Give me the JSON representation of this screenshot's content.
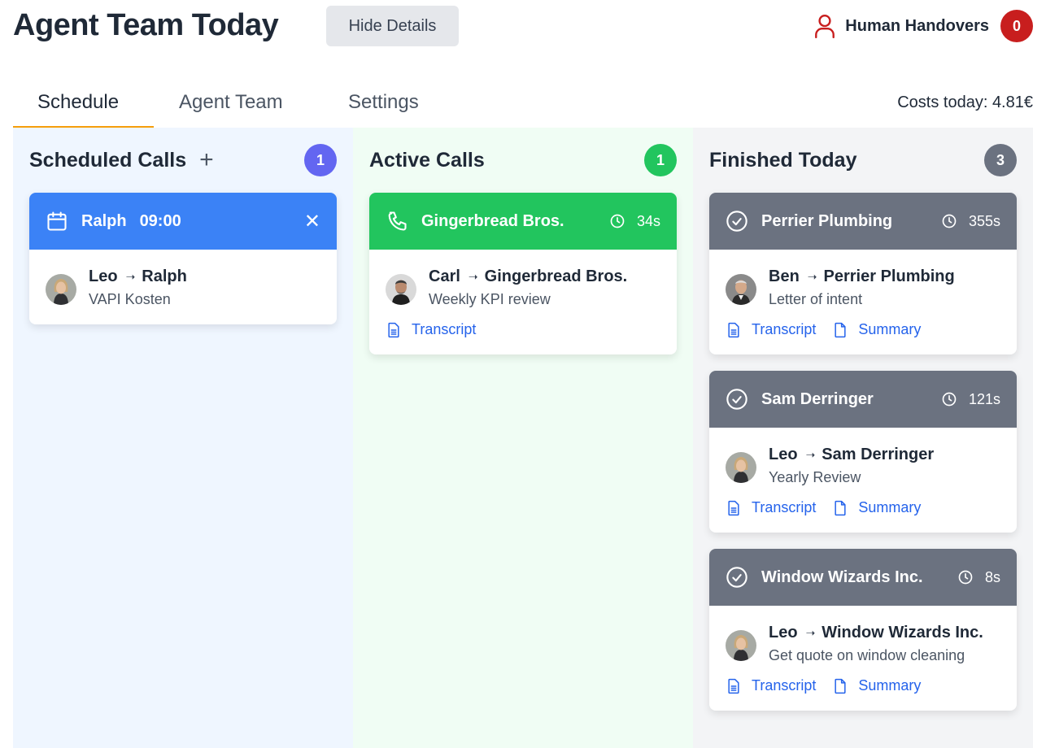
{
  "header": {
    "title": "Agent Team Today",
    "hide_details": "Hide Details",
    "handovers_label": "Human Handovers",
    "handovers_count": "0"
  },
  "tabs": [
    {
      "label": "Schedule"
    },
    {
      "label": "Agent Team"
    },
    {
      "label": "Settings"
    }
  ],
  "costs": "Costs today: 4.81€",
  "columns": {
    "scheduled": {
      "title": "Scheduled Calls",
      "count": "1",
      "cards": [
        {
          "name": "Ralph",
          "time": "09:00",
          "from": "Leo",
          "to": "Ralph",
          "topic": "VAPI Kosten"
        }
      ]
    },
    "active": {
      "title": "Active Calls",
      "count": "1",
      "cards": [
        {
          "name": "Gingerbread Bros.",
          "duration": "34s",
          "from": "Carl",
          "to": "Gingerbread Bros.",
          "topic": "Weekly KPI review",
          "transcript": "Transcript"
        }
      ]
    },
    "finished": {
      "title": "Finished Today",
      "count": "3",
      "cards": [
        {
          "name": "Perrier Plumbing",
          "duration": "355s",
          "from": "Ben",
          "to": "Perrier Plumbing",
          "topic": "Letter of intent",
          "transcript": "Transcript",
          "summary": "Summary"
        },
        {
          "name": "Sam Derringer",
          "duration": "121s",
          "from": "Leo",
          "to": "Sam Derringer",
          "topic": "Yearly Review",
          "transcript": "Transcript",
          "summary": "Summary"
        },
        {
          "name": "Window Wizards Inc.",
          "duration": "8s",
          "from": "Leo",
          "to": "Window Wizards Inc.",
          "topic": "Get quote on window cleaning",
          "transcript": "Transcript",
          "summary": "Summary"
        }
      ]
    }
  },
  "colors": {
    "scheduled_head": "#3b82f6",
    "active_head": "#22c55e",
    "finished_head": "#6b7280",
    "scheduled_badge": "#6366f1",
    "active_badge": "#22c55e",
    "finished_badge": "#6b7280",
    "handover_badge": "#c81e1e",
    "tab_accent": "#f59e0b",
    "link": "#2563eb"
  },
  "icons": {
    "handover": "person-icon",
    "scheduled": "calendar-icon",
    "active": "phone-icon",
    "finished": "check-circle-icon",
    "duration": "clock-icon",
    "transcript": "document-lines-icon",
    "summary": "document-icon",
    "close": "close-icon",
    "add": "plus-icon",
    "arrow": "arrow-right-icon"
  }
}
